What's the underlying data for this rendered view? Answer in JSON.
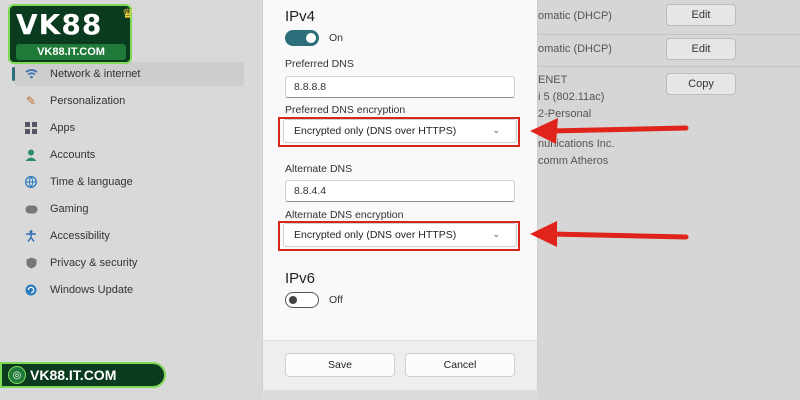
{
  "sidebar": {
    "items": [
      {
        "label": "Network & internet",
        "icon": "wifi-icon",
        "active": true
      },
      {
        "label": "Personalization",
        "icon": "brush-icon"
      },
      {
        "label": "Apps",
        "icon": "apps-icon"
      },
      {
        "label": "Accounts",
        "icon": "person-icon"
      },
      {
        "label": "Time & language",
        "icon": "globe-icon"
      },
      {
        "label": "Gaming",
        "icon": "gamepad-icon"
      },
      {
        "label": "Accessibility",
        "icon": "accessibility-icon"
      },
      {
        "label": "Privacy & security",
        "icon": "shield-icon"
      },
      {
        "label": "Windows Update",
        "icon": "update-icon"
      }
    ]
  },
  "right_pane": {
    "row1_text": "omatic (DHCP)",
    "row1_button": "Edit",
    "row2_text": "omatic (DHCP)",
    "row2_button": "Edit",
    "details": [
      "ENET",
      "i 5 (802.11ac)",
      "2-Personal",
      "nunications Inc.",
      "comm Atheros"
    ],
    "copy_button": "Copy"
  },
  "dialog": {
    "ipv4_title": "IPv4",
    "ipv4_toggle_label": "On",
    "preferred_dns_label": "Preferred DNS",
    "preferred_dns_value": "8.8.8.8",
    "preferred_enc_label": "Preferred DNS encryption",
    "preferred_enc_value": "Encrypted only (DNS over HTTPS)",
    "alternate_dns_label": "Alternate DNS",
    "alternate_dns_value": "8.8.4.4",
    "alternate_enc_label": "Alternate DNS encryption",
    "alternate_enc_value": "Encrypted only (DNS over HTTPS)",
    "ipv6_title": "IPv6",
    "ipv6_toggle_label": "Off",
    "save_label": "Save",
    "cancel_label": "Cancel"
  },
  "branding": {
    "logo_main": "VK88",
    "logo_sub": "VK88.IT.COM",
    "badge_text": "VK88.IT.COM"
  },
  "colors": {
    "accent": "#2c6e7a",
    "highlight_red": "#d9251c",
    "brand_green": "#1f7a39"
  }
}
